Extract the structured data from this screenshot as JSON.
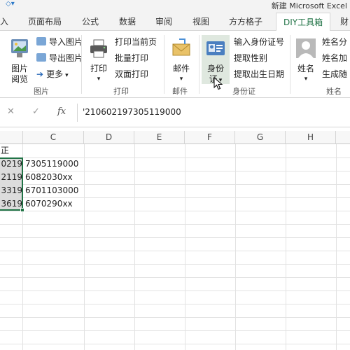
{
  "window": {
    "title": "新建 Microsoft Excel"
  },
  "tabs": [
    "入",
    "页面布局",
    "公式",
    "数据",
    "审阅",
    "视图",
    "方方格子",
    "DIY工具箱",
    "财"
  ],
  "ribbon": {
    "images": {
      "big_label_1": "图片",
      "big_label_2": "阅览",
      "import": "导入图片",
      "export": "导出图片",
      "more": "更多",
      "group": "图片"
    },
    "print": {
      "big_label": "打印",
      "current_page": "打印当前页",
      "batch": "批量打印",
      "duplex": "双面打印",
      "group": "打印"
    },
    "mail": {
      "big_label": "邮件",
      "group": "邮件"
    },
    "idcard": {
      "big_label_1": "身份",
      "big_label_2": "证",
      "input": "输入身份证号",
      "gender": "提取性别",
      "birthdate": "提取出生日期",
      "group": "身份证"
    },
    "name": {
      "big_label": "姓名",
      "item1": "姓名分",
      "item2": "姓名加",
      "item3": "生成随",
      "group": "姓名"
    }
  },
  "formula_bar": {
    "cancel": "✕",
    "confirm": "✓",
    "fx": "fx",
    "value": "'210602197305119000"
  },
  "columns": [
    "C",
    "D",
    "E",
    "F",
    "G",
    "H"
  ],
  "cells": {
    "header_fragment": "正",
    "b_values": [
      "0219",
      "2119",
      "3319",
      "3619"
    ],
    "c_values": [
      "7305119000",
      "6082030xx",
      "6701103000",
      "6070290xx"
    ]
  },
  "colors": {
    "accent": "#217346",
    "selection": "#217346"
  },
  "icons": [
    "picture-viewer-icon",
    "import-picture-icon",
    "export-picture-icon",
    "more-arrow-icon",
    "printer-icon",
    "print-page-icon",
    "batch-print-icon",
    "duplex-print-icon",
    "mail-icon",
    "id-card-icon",
    "name-person-icon",
    "mouse-cursor-icon"
  ]
}
